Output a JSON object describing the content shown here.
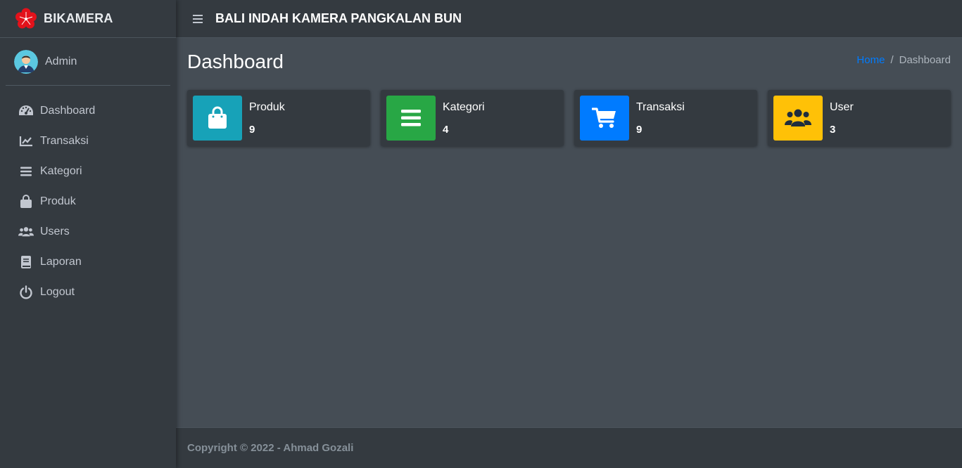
{
  "brand": {
    "name": "BIKAMERA",
    "logo_icon": "red-flower-logo"
  },
  "user": {
    "name": "Admin",
    "avatar_icon": "user-avatar"
  },
  "sidebar": {
    "items": [
      {
        "label": "Dashboard",
        "icon": "tachometer-icon"
      },
      {
        "label": "Transaksi",
        "icon": "chart-line-icon"
      },
      {
        "label": "Kategori",
        "icon": "list-icon"
      },
      {
        "label": "Produk",
        "icon": "shopping-bag-icon"
      },
      {
        "label": "Users",
        "icon": "users-icon"
      },
      {
        "label": "Laporan",
        "icon": "book-icon"
      },
      {
        "label": "Logout",
        "icon": "power-icon"
      }
    ]
  },
  "topbar": {
    "title": "BALI INDAH KAMERA PANGKALAN BUN",
    "menu_icon": "hamburger-icon"
  },
  "page": {
    "title": "Dashboard",
    "breadcrumb": {
      "home": "Home",
      "separator": "/",
      "current": "Dashboard"
    }
  },
  "boxes": [
    {
      "label": "Produk",
      "value": "9",
      "color": "#17a2b8",
      "icon": "shopping-bag-icon"
    },
    {
      "label": "Kategori",
      "value": "4",
      "color": "#28a745",
      "icon": "list-icon"
    },
    {
      "label": "Transaksi",
      "value": "9",
      "color": "#007bff",
      "icon": "shopping-cart-icon"
    },
    {
      "label": "User",
      "value": "3",
      "color": "#ffc107",
      "icon": "users-icon"
    }
  ],
  "footer": {
    "text": "Copyright © 2022 - Ahmad Gozali"
  }
}
